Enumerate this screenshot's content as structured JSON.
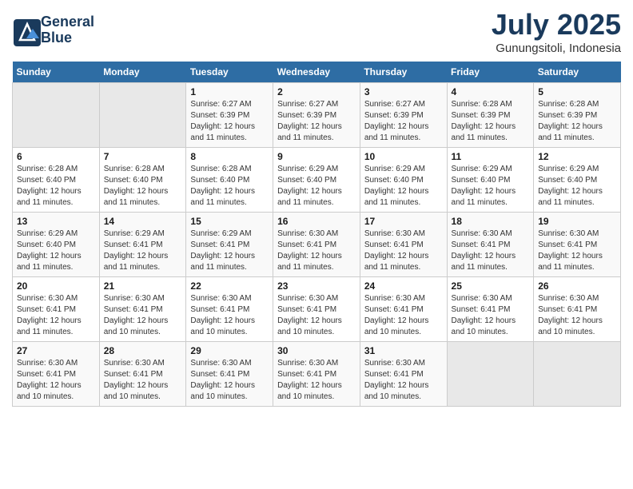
{
  "header": {
    "logo_line1": "General",
    "logo_line2": "Blue",
    "title": "July 2025",
    "subtitle": "Gunungsitoli, Indonesia"
  },
  "calendar": {
    "headers": [
      "Sunday",
      "Monday",
      "Tuesday",
      "Wednesday",
      "Thursday",
      "Friday",
      "Saturday"
    ],
    "weeks": [
      [
        {
          "day": "",
          "empty": true
        },
        {
          "day": "",
          "empty": true
        },
        {
          "day": "1",
          "sunrise": "Sunrise: 6:27 AM",
          "sunset": "Sunset: 6:39 PM",
          "daylight": "Daylight: 12 hours and 11 minutes."
        },
        {
          "day": "2",
          "sunrise": "Sunrise: 6:27 AM",
          "sunset": "Sunset: 6:39 PM",
          "daylight": "Daylight: 12 hours and 11 minutes."
        },
        {
          "day": "3",
          "sunrise": "Sunrise: 6:27 AM",
          "sunset": "Sunset: 6:39 PM",
          "daylight": "Daylight: 12 hours and 11 minutes."
        },
        {
          "day": "4",
          "sunrise": "Sunrise: 6:28 AM",
          "sunset": "Sunset: 6:39 PM",
          "daylight": "Daylight: 12 hours and 11 minutes."
        },
        {
          "day": "5",
          "sunrise": "Sunrise: 6:28 AM",
          "sunset": "Sunset: 6:39 PM",
          "daylight": "Daylight: 12 hours and 11 minutes."
        }
      ],
      [
        {
          "day": "6",
          "sunrise": "Sunrise: 6:28 AM",
          "sunset": "Sunset: 6:40 PM",
          "daylight": "Daylight: 12 hours and 11 minutes."
        },
        {
          "day": "7",
          "sunrise": "Sunrise: 6:28 AM",
          "sunset": "Sunset: 6:40 PM",
          "daylight": "Daylight: 12 hours and 11 minutes."
        },
        {
          "day": "8",
          "sunrise": "Sunrise: 6:28 AM",
          "sunset": "Sunset: 6:40 PM",
          "daylight": "Daylight: 12 hours and 11 minutes."
        },
        {
          "day": "9",
          "sunrise": "Sunrise: 6:29 AM",
          "sunset": "Sunset: 6:40 PM",
          "daylight": "Daylight: 12 hours and 11 minutes."
        },
        {
          "day": "10",
          "sunrise": "Sunrise: 6:29 AM",
          "sunset": "Sunset: 6:40 PM",
          "daylight": "Daylight: 12 hours and 11 minutes."
        },
        {
          "day": "11",
          "sunrise": "Sunrise: 6:29 AM",
          "sunset": "Sunset: 6:40 PM",
          "daylight": "Daylight: 12 hours and 11 minutes."
        },
        {
          "day": "12",
          "sunrise": "Sunrise: 6:29 AM",
          "sunset": "Sunset: 6:40 PM",
          "daylight": "Daylight: 12 hours and 11 minutes."
        }
      ],
      [
        {
          "day": "13",
          "sunrise": "Sunrise: 6:29 AM",
          "sunset": "Sunset: 6:40 PM",
          "daylight": "Daylight: 12 hours and 11 minutes."
        },
        {
          "day": "14",
          "sunrise": "Sunrise: 6:29 AM",
          "sunset": "Sunset: 6:41 PM",
          "daylight": "Daylight: 12 hours and 11 minutes."
        },
        {
          "day": "15",
          "sunrise": "Sunrise: 6:29 AM",
          "sunset": "Sunset: 6:41 PM",
          "daylight": "Daylight: 12 hours and 11 minutes."
        },
        {
          "day": "16",
          "sunrise": "Sunrise: 6:30 AM",
          "sunset": "Sunset: 6:41 PM",
          "daylight": "Daylight: 12 hours and 11 minutes."
        },
        {
          "day": "17",
          "sunrise": "Sunrise: 6:30 AM",
          "sunset": "Sunset: 6:41 PM",
          "daylight": "Daylight: 12 hours and 11 minutes."
        },
        {
          "day": "18",
          "sunrise": "Sunrise: 6:30 AM",
          "sunset": "Sunset: 6:41 PM",
          "daylight": "Daylight: 12 hours and 11 minutes."
        },
        {
          "day": "19",
          "sunrise": "Sunrise: 6:30 AM",
          "sunset": "Sunset: 6:41 PM",
          "daylight": "Daylight: 12 hours and 11 minutes."
        }
      ],
      [
        {
          "day": "20",
          "sunrise": "Sunrise: 6:30 AM",
          "sunset": "Sunset: 6:41 PM",
          "daylight": "Daylight: 12 hours and 11 minutes."
        },
        {
          "day": "21",
          "sunrise": "Sunrise: 6:30 AM",
          "sunset": "Sunset: 6:41 PM",
          "daylight": "Daylight: 12 hours and 10 minutes."
        },
        {
          "day": "22",
          "sunrise": "Sunrise: 6:30 AM",
          "sunset": "Sunset: 6:41 PM",
          "daylight": "Daylight: 12 hours and 10 minutes."
        },
        {
          "day": "23",
          "sunrise": "Sunrise: 6:30 AM",
          "sunset": "Sunset: 6:41 PM",
          "daylight": "Daylight: 12 hours and 10 minutes."
        },
        {
          "day": "24",
          "sunrise": "Sunrise: 6:30 AM",
          "sunset": "Sunset: 6:41 PM",
          "daylight": "Daylight: 12 hours and 10 minutes."
        },
        {
          "day": "25",
          "sunrise": "Sunrise: 6:30 AM",
          "sunset": "Sunset: 6:41 PM",
          "daylight": "Daylight: 12 hours and 10 minutes."
        },
        {
          "day": "26",
          "sunrise": "Sunrise: 6:30 AM",
          "sunset": "Sunset: 6:41 PM",
          "daylight": "Daylight: 12 hours and 10 minutes."
        }
      ],
      [
        {
          "day": "27",
          "sunrise": "Sunrise: 6:30 AM",
          "sunset": "Sunset: 6:41 PM",
          "daylight": "Daylight: 12 hours and 10 minutes."
        },
        {
          "day": "28",
          "sunrise": "Sunrise: 6:30 AM",
          "sunset": "Sunset: 6:41 PM",
          "daylight": "Daylight: 12 hours and 10 minutes."
        },
        {
          "day": "29",
          "sunrise": "Sunrise: 6:30 AM",
          "sunset": "Sunset: 6:41 PM",
          "daylight": "Daylight: 12 hours and 10 minutes."
        },
        {
          "day": "30",
          "sunrise": "Sunrise: 6:30 AM",
          "sunset": "Sunset: 6:41 PM",
          "daylight": "Daylight: 12 hours and 10 minutes."
        },
        {
          "day": "31",
          "sunrise": "Sunrise: 6:30 AM",
          "sunset": "Sunset: 6:41 PM",
          "daylight": "Daylight: 12 hours and 10 minutes."
        },
        {
          "day": "",
          "empty": true
        },
        {
          "day": "",
          "empty": true
        }
      ]
    ]
  }
}
